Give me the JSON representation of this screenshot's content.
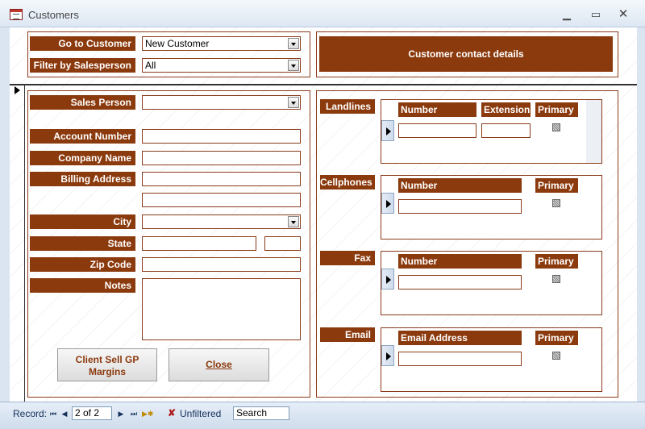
{
  "window": {
    "title": "Customers",
    "minimize": "▁",
    "maximize": "▭",
    "close": "✕"
  },
  "header": {
    "goto_label": "Go to Customer",
    "goto_value": "New Customer",
    "filter_label": "Filter by Salesperson",
    "filter_value": "All",
    "contact_button": "Customer contact details"
  },
  "form": {
    "sales_person": "Sales Person",
    "account_number": "Account Number",
    "company_name": "Company Name",
    "billing_address": "Billing Address",
    "city": "City",
    "state": "State",
    "zip_code": "Zip Code",
    "notes": "Notes",
    "client_sell_button_line1": "Client Sell GP",
    "client_sell_button_line2": "Margins",
    "close_button": "Close"
  },
  "contacts": {
    "landlines": {
      "label": "Landlines",
      "col_number": "Number",
      "col_extension": "Extension",
      "col_primary": "Primary"
    },
    "cellphones": {
      "label": "Cellphones",
      "col_number": "Number",
      "col_primary": "Primary"
    },
    "fax": {
      "label": "Fax",
      "col_number": "Number",
      "col_primary": "Primary"
    },
    "email": {
      "label": "Email",
      "col_address": "Email Address",
      "col_primary": "Primary"
    }
  },
  "statusbar": {
    "record_label": "Record:",
    "record_position": "2 of 2",
    "filter_status": "Unfiltered",
    "search_placeholder": "Search"
  }
}
